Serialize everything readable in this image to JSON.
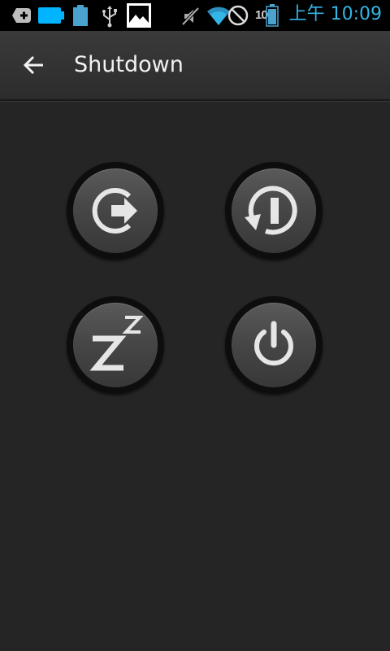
{
  "status_bar": {
    "battery_percent": "100",
    "time": "上午 10:09",
    "icons": [
      "add-icon",
      "battery-full-icon",
      "battery-icon",
      "usb-icon",
      "gallery-icon",
      "mute-icon",
      "wifi-icon",
      "blocked-icon"
    ],
    "colors": {
      "time": "#33b5e5",
      "accent": "#00b4ff"
    }
  },
  "action_bar": {
    "title": "Shutdown",
    "back_icon": "arrow-left-icon"
  },
  "actions": [
    {
      "id": "logout",
      "icon": "logout-icon"
    },
    {
      "id": "restart",
      "icon": "restart-icon"
    },
    {
      "id": "sleep",
      "icon": "sleep-icon"
    },
    {
      "id": "power",
      "icon": "power-icon"
    }
  ]
}
